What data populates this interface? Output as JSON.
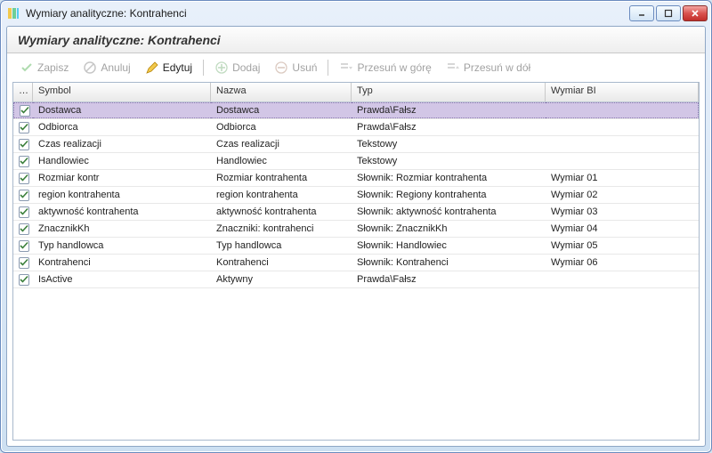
{
  "window": {
    "title": "Wymiary analityczne: Kontrahenci"
  },
  "header": "Wymiary analityczne: Kontrahenci",
  "toolbar": {
    "save": "Zapisz",
    "cancel": "Anuluj",
    "edit": "Edytuj",
    "add": "Dodaj",
    "delete": "Usuń",
    "moveUp": "Przesuń w górę",
    "moveDown": "Przesuń w dół"
  },
  "columns": {
    "check": "…",
    "symbol": "Symbol",
    "nazwa": "Nazwa",
    "typ": "Typ",
    "wymiarBI": "Wymiar BI"
  },
  "rows": [
    {
      "checked": true,
      "symbol": "Dostawca",
      "nazwa": "Dostawca",
      "typ": "Prawda\\Fałsz",
      "wymiarBI": "",
      "selected": true
    },
    {
      "checked": true,
      "symbol": "Odbiorca",
      "nazwa": "Odbiorca",
      "typ": "Prawda\\Fałsz",
      "wymiarBI": ""
    },
    {
      "checked": true,
      "symbol": "Czas realizacji",
      "nazwa": "Czas realizacji",
      "typ": "Tekstowy",
      "wymiarBI": ""
    },
    {
      "checked": true,
      "symbol": "Handlowiec",
      "nazwa": "Handlowiec",
      "typ": "Tekstowy",
      "wymiarBI": ""
    },
    {
      "checked": true,
      "symbol": "Rozmiar kontr",
      "nazwa": "Rozmiar kontrahenta",
      "typ": "Słownik: Rozmiar kontrahenta",
      "wymiarBI": "Wymiar 01"
    },
    {
      "checked": true,
      "symbol": "region kontrahenta",
      "nazwa": "region kontrahenta",
      "typ": "Słownik: Regiony kontrahenta",
      "wymiarBI": "Wymiar 02"
    },
    {
      "checked": true,
      "symbol": "aktywność kontrahenta",
      "nazwa": "aktywność kontrahenta",
      "typ": "Słownik: aktywność kontrahenta",
      "wymiarBI": "Wymiar 03"
    },
    {
      "checked": true,
      "symbol": "ZnacznikKh",
      "nazwa": "Znaczniki: kontrahenci",
      "typ": "Słownik: ZnacznikKh",
      "wymiarBI": "Wymiar 04"
    },
    {
      "checked": true,
      "symbol": "Typ handlowca",
      "nazwa": "Typ handlowca",
      "typ": "Słownik: Handlowiec",
      "wymiarBI": "Wymiar 05"
    },
    {
      "checked": true,
      "symbol": "Kontrahenci",
      "nazwa": "Kontrahenci",
      "typ": "Słownik: Kontrahenci",
      "wymiarBI": "Wymiar 06"
    },
    {
      "checked": true,
      "symbol": "IsActive",
      "nazwa": "Aktywny",
      "typ": "Prawda\\Fałsz",
      "wymiarBI": ""
    }
  ]
}
